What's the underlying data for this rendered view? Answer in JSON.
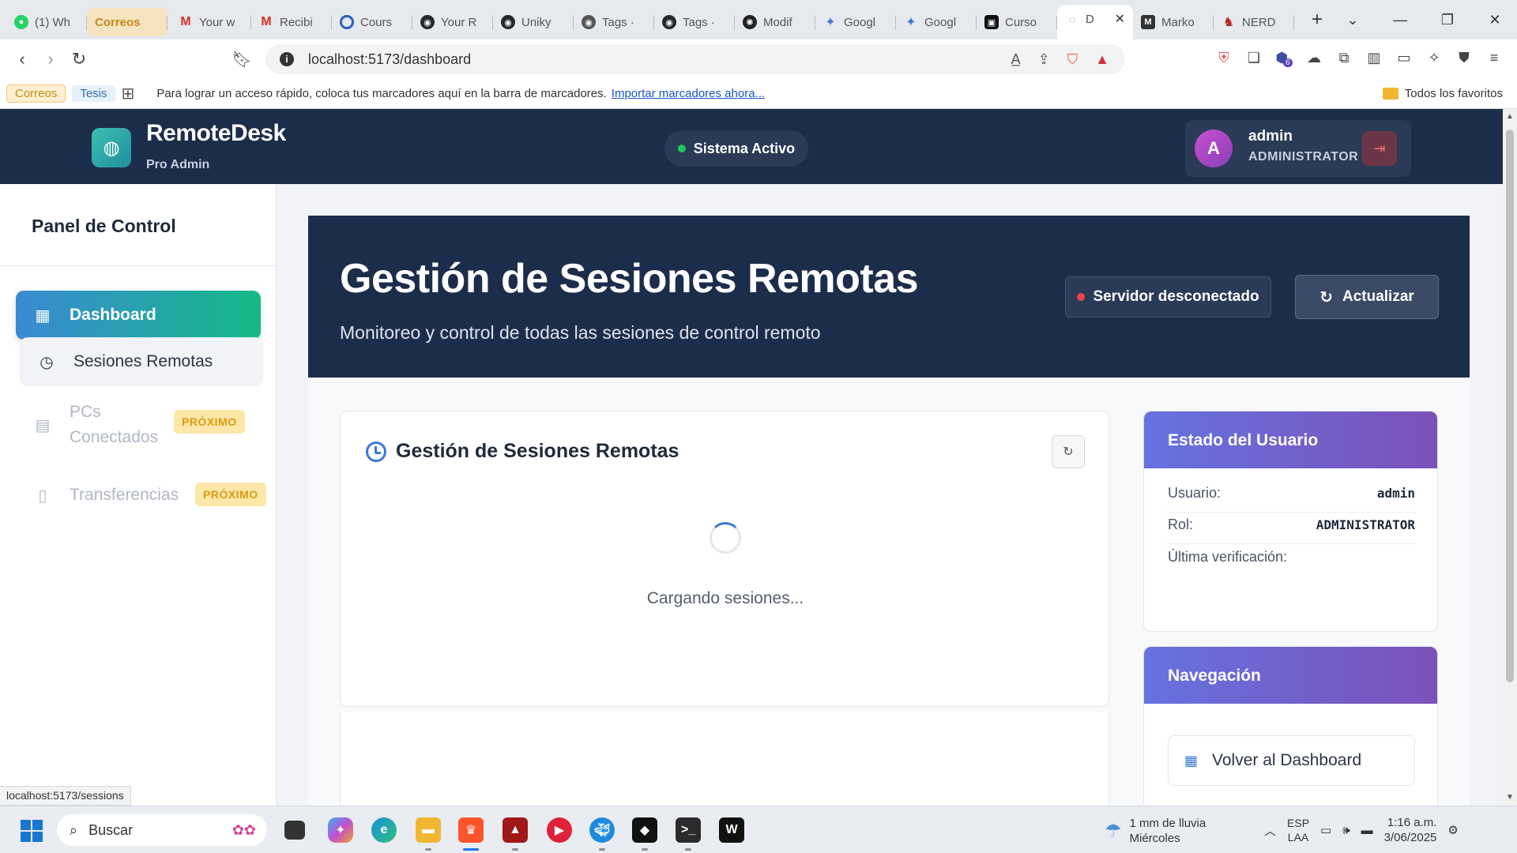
{
  "browser": {
    "tabs": [
      {
        "label": "(1) Wh",
        "icon": "whatsapp-icon",
        "color": "#25d366"
      },
      {
        "label": "Correos",
        "icon": "group-icon",
        "color": "#f0b429"
      },
      {
        "label": "Your w",
        "icon": "gmail-icon",
        "color": "#d93025"
      },
      {
        "label": "Recibi",
        "icon": "gmail-icon",
        "color": "#d93025"
      },
      {
        "label": "Cours",
        "icon": "coursera-icon",
        "color": "#2a5fbd"
      },
      {
        "label": "Your R",
        "icon": "github-icon",
        "color": "#24292f"
      },
      {
        "label": "Uniky",
        "icon": "github-icon",
        "color": "#24292f"
      },
      {
        "label": "Tags ·",
        "icon": "github-icon",
        "color": "#555555"
      },
      {
        "label": "Tags ·",
        "icon": "github-icon",
        "color": "#24292f"
      },
      {
        "label": "Modif",
        "icon": "openai-icon",
        "color": "#222222"
      },
      {
        "label": "Googl",
        "icon": "gemini-icon",
        "color": "#3a7bd5"
      },
      {
        "label": "Googl",
        "icon": "gemini-icon",
        "color": "#3a7bd5"
      },
      {
        "label": "Curso",
        "icon": "app-icon",
        "color": "#111111"
      },
      {
        "label": "D",
        "icon": "globe-icon",
        "color": "#888888"
      },
      {
        "label": "Marko",
        "icon": "m-icon",
        "color": "#333333"
      },
      {
        "label": "NERD",
        "icon": "nerd-icon",
        "color": "#b3261e"
      }
    ],
    "url": "localhost:5173/dashboard",
    "bookmarks": {
      "correos": "Correos",
      "tesis": "Tesis",
      "message": "Para lograr un acceso rápido, coloca tus marcadores aquí en la barra de marcadores.",
      "import_link": "Importar marcadores ahora...",
      "all_favorites": "Todos los favoritos"
    },
    "status_url": "localhost:5173/sessions",
    "extension_badge": "6"
  },
  "app": {
    "brand": {
      "title": "RemoteDesk",
      "subtitle": "Pro Admin"
    },
    "system_status": "Sistema Activo",
    "user": {
      "initial": "A",
      "name": "admin",
      "role": "ADMINISTRATOR"
    },
    "sidebar": {
      "title": "Panel de Control",
      "items": [
        {
          "label": "Dashboard",
          "icon": "grid-icon"
        },
        {
          "label": "Sesiones Remotas",
          "icon": "clock-icon"
        },
        {
          "label": "PCs Conectados",
          "icon": "document-icon",
          "badge": "PRÓXIMO"
        },
        {
          "label": "Transferencias",
          "icon": "file-icon",
          "badge": "PRÓXIMO"
        }
      ]
    },
    "hero": {
      "title": "Gestión de Sesiones Remotas",
      "subtitle": "Monitoreo y control de todas las sesiones de control remoto",
      "server_status": "Servidor desconectado",
      "refresh_label": "Actualizar"
    },
    "sessions_card": {
      "title": "Gestión de Sesiones Remotas",
      "loading_text": "Cargando sesiones..."
    },
    "user_card": {
      "title": "Estado del Usuario",
      "rows": [
        {
          "label": "Usuario:",
          "value": "admin"
        },
        {
          "label": "Rol:",
          "value": "ADMINISTRATOR"
        },
        {
          "label": "Última verificación:",
          "value": ""
        }
      ]
    },
    "nav_card": {
      "title": "Navegación",
      "back_label": "Volver al Dashboard"
    }
  },
  "taskbar": {
    "search_placeholder": "Buscar",
    "weather": {
      "line1": "1 mm de lluvia",
      "line2": "Miércoles"
    },
    "lang": {
      "line1": "ESP",
      "line2": "LAA"
    },
    "time": "1:16 a.m.",
    "date": "3/06/2025"
  },
  "colors": {
    "active_gradient_start": "#3a8ad4",
    "active_gradient_end": "#15b987",
    "header_bg": "#1c2d4b",
    "card_header_start": "#6672e0",
    "card_header_end": "#7b52b8"
  }
}
